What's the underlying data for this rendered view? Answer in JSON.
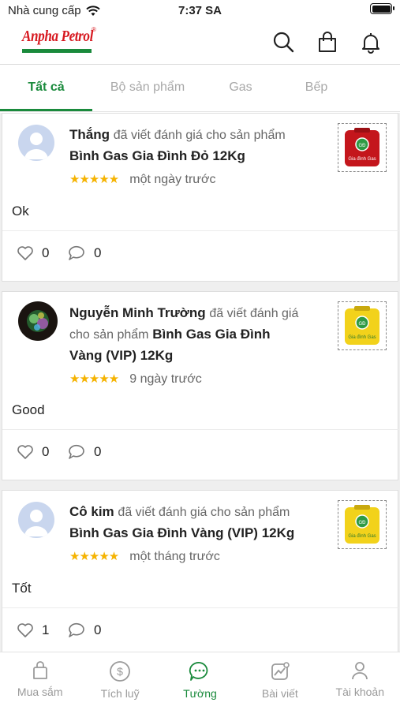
{
  "status": {
    "carrier": "Nhà cung cấp",
    "time": "7:37 SA"
  },
  "header": {
    "logo_text": "Anpha Petrol",
    "logo_mark": "®"
  },
  "tabs": [
    {
      "label": "Tất cả",
      "active": true
    },
    {
      "label": "Bộ sản phẩm",
      "active": false
    },
    {
      "label": "Gas",
      "active": false
    },
    {
      "label": "Bếp",
      "active": false
    }
  ],
  "reviews": [
    {
      "name": "Thắng",
      "wrote": "đã viết đánh giá cho sản phẩm",
      "product": "Bình Gas Gia Đình Đỏ 12Kg",
      "rating": 5,
      "stars": "★★★★★",
      "time": "một ngày trước",
      "comment": "Ok",
      "likes": "0",
      "comments": "0",
      "thumb_label": "Gia đình Gas",
      "thumb_color": "#c4161c"
    },
    {
      "name": "Nguyễn Minh Trường",
      "wrote": "đã viết đánh giá cho sản phẩm",
      "product": "Bình Gas Gia Đình Vàng (VIP) 12Kg",
      "rating": 5,
      "stars": "★★★★★",
      "time": "9 ngày trước",
      "comment": "Good",
      "likes": "0",
      "comments": "0",
      "thumb_label": "Gia đình Gas",
      "thumb_color": "#f2d21b"
    },
    {
      "name": "Cô kim",
      "wrote": "đã viết đánh giá cho sản phẩm",
      "product": "Bình Gas Gia Đình Vàng (VIP) 12Kg",
      "rating": 5,
      "stars": "★★★★★",
      "time": "một tháng trước",
      "comment": "Tốt",
      "likes": "1",
      "comments": "0",
      "thumb_label": "Gia đình Gas",
      "thumb_color": "#f2d21b"
    }
  ],
  "bottom_nav": [
    {
      "label": "Mua sắm",
      "icon": "bag-icon",
      "active": false
    },
    {
      "label": "Tích luỹ",
      "icon": "dollar-icon",
      "active": false
    },
    {
      "label": "Tường",
      "icon": "chat-icon",
      "active": true
    },
    {
      "label": "Bài viết",
      "icon": "chart-icon",
      "active": false
    },
    {
      "label": "Tài khoản",
      "icon": "user-icon",
      "active": false
    }
  ],
  "colors": {
    "brand_green": "#1a8a3c",
    "brand_red": "#d71920",
    "star": "#f5b301"
  }
}
